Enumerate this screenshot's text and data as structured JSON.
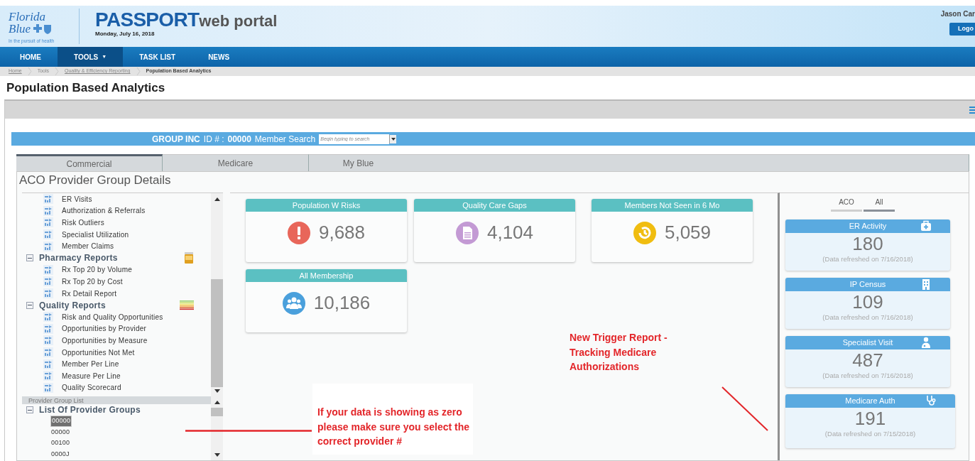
{
  "header": {
    "logo_line1": "Florida",
    "logo_line2": "Blue",
    "tagline": "In the pursuit of health",
    "brand": "PASSPORT",
    "brand_suffix": "web portal",
    "date": "Monday, July 16, 2018",
    "user": "Jason Car",
    "logout": "Logo"
  },
  "nav": [
    {
      "label": "HOME",
      "selected": false
    },
    {
      "label": "TOOLS",
      "caret": "▼",
      "selected": true
    },
    {
      "label": "TASK LIST",
      "selected": false
    },
    {
      "label": "NEWS",
      "selected": false
    }
  ],
  "breadcrumb": [
    {
      "label": "Home",
      "kind": "link"
    },
    {
      "label": "Tools",
      "kind": "plain"
    },
    {
      "label": "Quality & Efficiency Reporting",
      "kind": "link"
    },
    {
      "label": "Population Based Analytics",
      "kind": "current"
    }
  ],
  "page_title": "Population Based Analytics",
  "group_bar": {
    "group": "GROUP INC",
    "id_label": "ID # :",
    "id": "00000",
    "search_label": "Member Search",
    "search_placeholder": "Begin typing to search"
  },
  "tabs": [
    {
      "label": "Commercial",
      "selected": true
    },
    {
      "label": "Medicare",
      "selected": false
    },
    {
      "label": "My Blue",
      "selected": false
    }
  ],
  "panel_title": "ACO Provider Group Details",
  "report_tree": [
    {
      "kind": "item",
      "label": "ER Visits"
    },
    {
      "kind": "item",
      "label": "Authorization & Referrals"
    },
    {
      "kind": "item",
      "label": "Risk Outliers"
    },
    {
      "kind": "item",
      "label": "Specialist Utilization"
    },
    {
      "kind": "item",
      "label": "Member Claims"
    },
    {
      "kind": "section",
      "label": "Pharmacy Reports",
      "expanded": true,
      "children": [
        {
          "kind": "item",
          "label": "Rx Top 20 by Volume"
        },
        {
          "kind": "item",
          "label": "Rx Top 20 by Cost"
        },
        {
          "kind": "item",
          "label": "Rx Detail Report"
        }
      ]
    },
    {
      "kind": "section",
      "label": "Quality Reports",
      "expanded": true,
      "children": [
        {
          "kind": "item",
          "label": "Risk and Quality Opportunities"
        },
        {
          "kind": "item",
          "label": "Opportunities by Provider"
        },
        {
          "kind": "item",
          "label": "Opportunities by Measure"
        },
        {
          "kind": "item",
          "label": "Opportunities Not Met"
        },
        {
          "kind": "item",
          "label": "Member Per Line"
        },
        {
          "kind": "item",
          "label": "Measure Per Line"
        },
        {
          "kind": "item",
          "label": "Quality Scorecard"
        }
      ]
    }
  ],
  "provider_list": {
    "title": "Provider Group List",
    "section": "List Of Provider Groups",
    "expanded": true,
    "items": [
      {
        "label": "00000",
        "selected": true
      },
      {
        "label": "00000",
        "selected": false
      },
      {
        "label": "00100",
        "selected": false
      },
      {
        "label": "0000J",
        "selected": false
      }
    ]
  },
  "kpis": [
    {
      "title": "Population W Risks",
      "value": "9,688",
      "kind": "alert"
    },
    {
      "title": "Quality Care Gaps",
      "value": "4,104",
      "kind": "document"
    },
    {
      "title": "Members Not Seen in 6 Mo",
      "value": "5,059",
      "kind": "history"
    },
    {
      "title": "All Membership",
      "value": "10,186",
      "kind": "group"
    }
  ],
  "scope_toggle": [
    {
      "label": "ACO",
      "selected": false
    },
    {
      "label": "All",
      "selected": true
    }
  ],
  "activity_cards": [
    {
      "title": "ER Activity",
      "value": "180",
      "note": "(Data refreshed on 7/16/2018)",
      "kind": "er"
    },
    {
      "title": "IP Census",
      "value": "109",
      "note": "(Data refreshed on 7/16/2018)",
      "kind": "hospital"
    },
    {
      "title": "Specialist Visit",
      "value": "487",
      "note": "(Data refreshed on 7/16/2018)",
      "kind": "doctor"
    },
    {
      "title": "Medicare Auth",
      "value": "191",
      "note": "(Data refreshed on 7/15/2018)",
      "kind": "stethoscope"
    }
  ],
  "annotations": [
    {
      "text": "New Trigger Report - Tracking Medicare Authorizations"
    },
    {
      "text": "If your data is showing as zero please make sure you select the correct provider #"
    }
  ]
}
